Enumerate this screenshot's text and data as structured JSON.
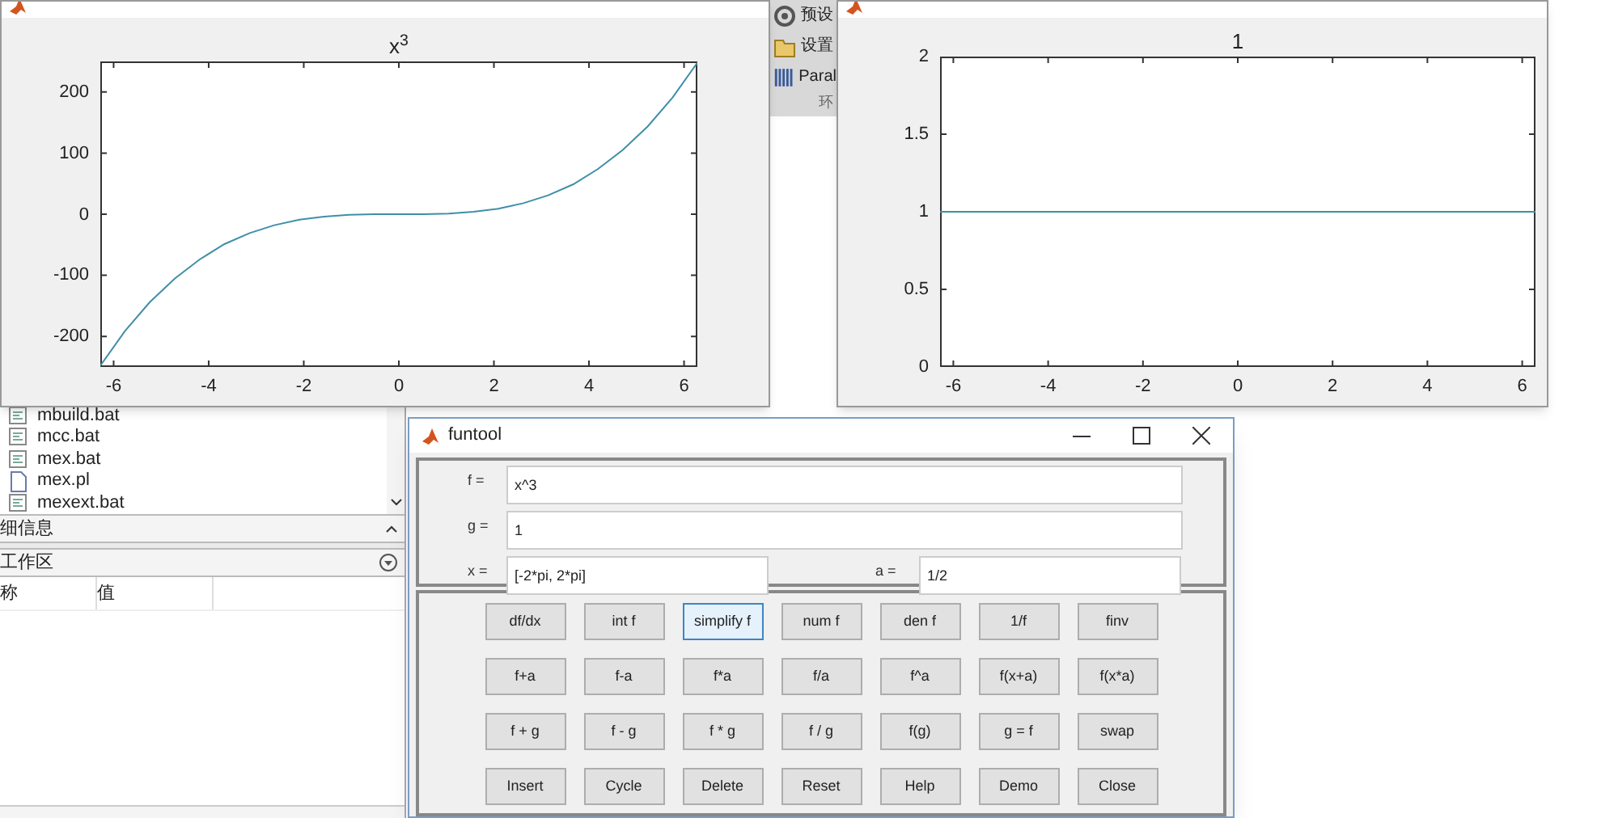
{
  "toolstrip": {
    "items": [
      {
        "label": "预设",
        "kind": "gear"
      },
      {
        "label": "设置",
        "kind": "folder"
      },
      {
        "label": "Paral",
        "kind": "bars"
      }
    ],
    "section": "环"
  },
  "figures": [
    {
      "title": "x$^{3}$",
      "chart_data": {
        "type": "line",
        "x": [
          -6.28,
          -5.76,
          -5.24,
          -4.71,
          -4.19,
          -3.67,
          -3.14,
          -2.62,
          -2.09,
          -1.57,
          -1.05,
          -0.52,
          0,
          0.52,
          1.05,
          1.57,
          2.09,
          2.62,
          3.14,
          3.67,
          4.19,
          4.71,
          5.24,
          5.76,
          6.28
        ],
        "xlim": [
          -6.28,
          6.28
        ],
        "ylim": [
          -250,
          250
        ],
        "xticks": [
          -6,
          -4,
          -2,
          0,
          2,
          4,
          6
        ],
        "yticks": [
          -200,
          -100,
          0,
          100,
          200
        ],
        "series": [
          {
            "color": "#3f8fa8",
            "values": [
              -248,
              -191,
              -144,
              -105,
              -74,
              -49,
              -31,
              -18,
              -9,
              -4,
              -1,
              0,
              0,
              0,
              1,
              4,
              9,
              18,
              31,
              49,
              74,
              105,
              144,
              191,
              248
            ]
          }
        ]
      }
    },
    {
      "title": "1",
      "chart_data": {
        "type": "line",
        "x": [
          -6.28,
          6.28
        ],
        "xlim": [
          -6.28,
          6.28
        ],
        "ylim": [
          0,
          2
        ],
        "xticks": [
          -6,
          -4,
          -2,
          0,
          2,
          4,
          6
        ],
        "yticks": [
          0,
          0.5,
          1,
          1.5,
          2
        ],
        "series": [
          {
            "color": "#3f8fa8",
            "values": [
              1,
              1
            ]
          }
        ]
      }
    }
  ],
  "file_list": [
    {
      "name": "mbuild.bat",
      "kind": "script"
    },
    {
      "name": "mcc.bat",
      "kind": "script"
    },
    {
      "name": "mex.bat",
      "kind": "script"
    },
    {
      "name": "mex.pl",
      "kind": "file"
    },
    {
      "name": "mexext.bat",
      "kind": "script"
    }
  ],
  "details_header": "细信息",
  "workspace": {
    "title": "工作区",
    "columns": [
      "称",
      "值"
    ]
  },
  "funtool": {
    "title": "funtool",
    "fields": [
      {
        "label": "f =",
        "value": "x^3"
      },
      {
        "label": "g =",
        "value": "1"
      },
      {
        "label": "x =",
        "value": "[-2*pi, 2*pi]"
      },
      {
        "label": "a =",
        "value": "1/2"
      }
    ],
    "buttons": [
      [
        {
          "label": "df/dx",
          "focused": false
        },
        {
          "label": "int f",
          "focused": false
        },
        {
          "label": "simplify f",
          "focused": true
        },
        {
          "label": "num f",
          "focused": false
        },
        {
          "label": "den f",
          "focused": false
        },
        {
          "label": "1/f",
          "focused": false
        },
        {
          "label": "finv",
          "focused": false
        }
      ],
      [
        {
          "label": "f+a",
          "focused": false
        },
        {
          "label": "f-a",
          "focused": false
        },
        {
          "label": "f*a",
          "focused": false
        },
        {
          "label": "f/a",
          "focused": false
        },
        {
          "label": "f^a",
          "focused": false
        },
        {
          "label": "f(x+a)",
          "focused": false
        },
        {
          "label": "f(x*a)",
          "focused": false
        }
      ],
      [
        {
          "label": "f + g",
          "focused": false
        },
        {
          "label": "f - g",
          "focused": false
        },
        {
          "label": "f * g",
          "focused": false
        },
        {
          "label": "f / g",
          "focused": false
        },
        {
          "label": "f(g)",
          "focused": false
        },
        {
          "label": "g = f",
          "focused": false
        },
        {
          "label": "swap",
          "focused": false
        }
      ],
      [
        {
          "label": "Insert",
          "focused": false
        },
        {
          "label": "Cycle",
          "focused": false
        },
        {
          "label": "Delete",
          "focused": false
        },
        {
          "label": "Reset",
          "focused": false
        },
        {
          "label": "Help",
          "focused": false
        },
        {
          "label": "Demo",
          "focused": false
        },
        {
          "label": "Close",
          "focused": false
        }
      ]
    ]
  }
}
